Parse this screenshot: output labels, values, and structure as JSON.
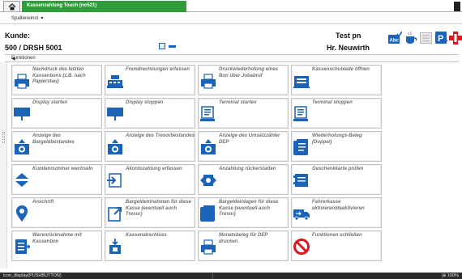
{
  "window": {
    "tab_title": "Kassenzahlung Touch (no521)"
  },
  "toolbar": {
    "column_settings": "Spalteneinst. ▾"
  },
  "header": {
    "customer_label": "Kunde:",
    "customer_value": "500 / DRSH 5001",
    "test_label": "Test pn",
    "user_name": "Hr. Neuwirth"
  },
  "functions_label": "Funktionen",
  "tiles": [
    {
      "label": "Nachdruck des letzten Kassenbons (z.B. nach Papierstau)",
      "icon": "printer-icon"
    },
    {
      "label": "Fremdrechnungen erfassen",
      "icon": "register-icon"
    },
    {
      "label": "Druckwiederholung eines Bon über Jobabruf",
      "icon": "printer-icon"
    },
    {
      "label": "Kassenschublade öffnen",
      "icon": "cash-drawer-icon"
    },
    {
      "label": "Display starten",
      "icon": "display-icon"
    },
    {
      "label": "Display stoppen",
      "icon": "display-icon"
    },
    {
      "label": "Terminal starten",
      "icon": "terminal-icon"
    },
    {
      "label": "Terminal stoppen",
      "icon": "terminal-icon"
    },
    {
      "label": "Anzeige des Bargeldbestandes",
      "icon": "money-box-icon"
    },
    {
      "label": "Anzeige des Tresorbestandes",
      "icon": "money-box-icon"
    },
    {
      "label": "Anzeige des Umsatzzähler DEP",
      "icon": "money-box-icon"
    },
    {
      "label": "Wiederholungs-Beleg (Doppel)",
      "icon": "receipt-scroll-icon"
    },
    {
      "label": "Kundennummer wechseln",
      "icon": "swap-icon"
    },
    {
      "label": "Akontozahlung erfassen",
      "icon": "payment-in-icon"
    },
    {
      "label": "Anzahlung rückerstatten",
      "icon": "refund-icon"
    },
    {
      "label": "Geschenkkarte prüfen",
      "icon": "gift-card-icon"
    },
    {
      "label": "Anschrift",
      "icon": "location-pin-icon"
    },
    {
      "label": "Bargeldentnahmen für diese Kasse (eventuell auch Tresor)",
      "icon": "cash-out-icon"
    },
    {
      "label": "Bargeldeinlagen für diese Kasse (eventuell auch Tresor)",
      "icon": "receipt-scroll-icon"
    },
    {
      "label": "Fahrerkasse aktivieren/deaktivieren",
      "icon": "delivery-truck-icon"
    },
    {
      "label": "Warenrücknahme mit Kassenbon",
      "icon": "return-goods-icon"
    },
    {
      "label": "Kassenabschluss",
      "icon": "cash-close-icon"
    },
    {
      "label": "Monatsbeleg für DEP drucken",
      "icon": "printer-icon"
    },
    {
      "label": "Funktionen schließen",
      "icon": "no-entry-icon"
    }
  ],
  "status_bar": {
    "left": "icon_display(PUSHBUTTON)",
    "zoom": "100%"
  },
  "colors": {
    "tab_green": "#2f9d3a",
    "icon_blue": "#1a63b8",
    "stop_red": "#d9181f"
  }
}
